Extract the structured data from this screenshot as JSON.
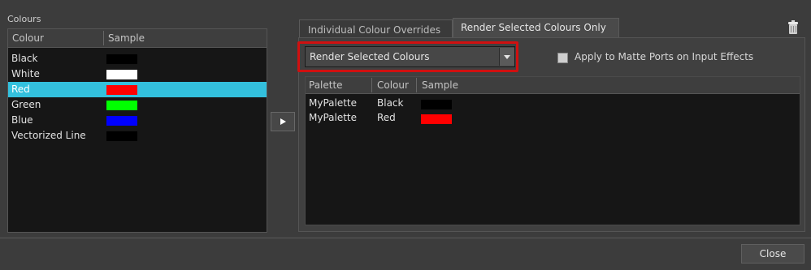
{
  "colours_panel": {
    "title": "Colours",
    "columns": [
      "Colour",
      "Sample"
    ],
    "rows": [
      {
        "name": "Black",
        "color": "#000000",
        "selected": false
      },
      {
        "name": "White",
        "color": "#ffffff",
        "selected": false
      },
      {
        "name": "Red",
        "color": "#ff0000",
        "selected": true
      },
      {
        "name": "Green",
        "color": "#00ff00",
        "selected": false
      },
      {
        "name": "Blue",
        "color": "#0000ff",
        "selected": false
      },
      {
        "name": "Vectorized Line",
        "color": "#000000",
        "selected": false
      }
    ]
  },
  "transfer_button": {
    "icon": "right-arrow-icon"
  },
  "tabs": [
    {
      "label": "Individual Colour Overrides",
      "active": false
    },
    {
      "label": "Render Selected Colours Only",
      "active": true
    }
  ],
  "toolbar": {
    "trash_icon": "trash-icon"
  },
  "render_mode": {
    "selected": "Render Selected Colours",
    "highlight_color": "#d01010"
  },
  "matte_option": {
    "label": "Apply to Matte Ports on Input Effects",
    "checked": false
  },
  "palette_table": {
    "columns": [
      "Palette",
      "Colour",
      "Sample"
    ],
    "rows": [
      {
        "palette": "MyPalette",
        "colour": "Black",
        "color": "#000000"
      },
      {
        "palette": "MyPalette",
        "colour": "Red",
        "color": "#ff0000"
      }
    ]
  },
  "footer": {
    "close_label": "Close"
  },
  "theme": {
    "selection_color": "#33c0dd",
    "background": "#3c3c3c"
  }
}
